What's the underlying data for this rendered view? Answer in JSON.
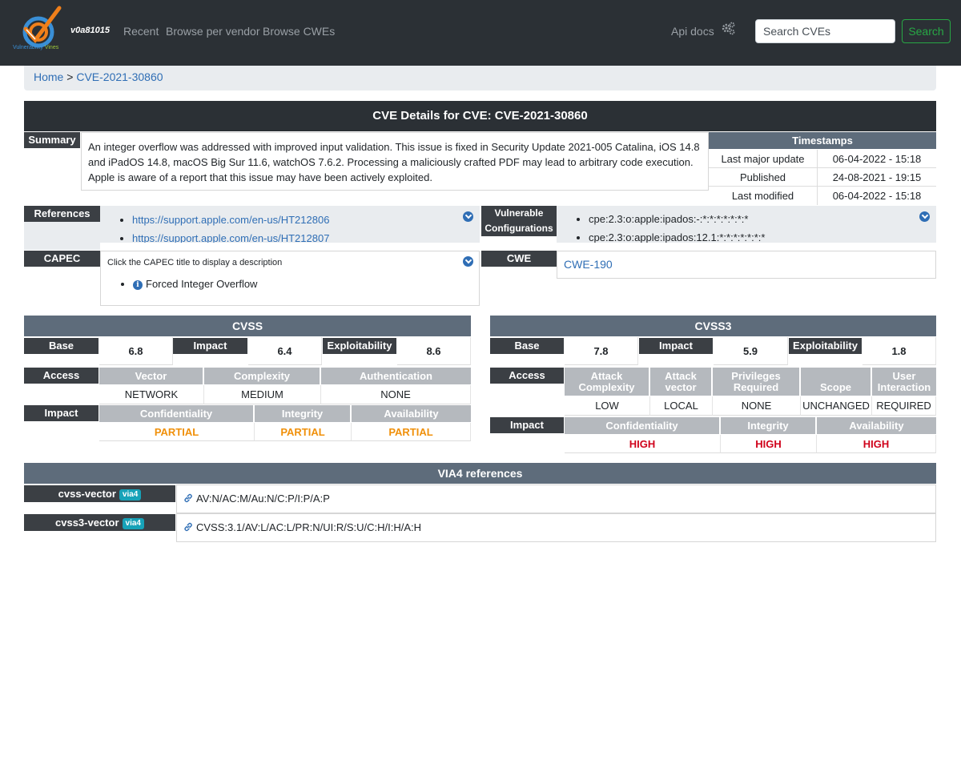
{
  "nav": {
    "brand_line1": "Vulnerability",
    "brand_line2": "Vines",
    "version": "v0a81015",
    "links": [
      "Recent",
      "Browse per vendor",
      "Browse CWEs"
    ],
    "api_docs": "Api docs",
    "search_placeholder": "Search CVEs",
    "search_button": "Search"
  },
  "breadcrumb": {
    "home": "Home",
    "sep": ">",
    "current": "CVE-2021-30860"
  },
  "title": "CVE Details for CVE: CVE-2021-30860",
  "summary": {
    "label": "Summary",
    "text": "An integer overflow was addressed with improved input validation. This issue is fixed in Security Update 2021-005 Catalina, iOS 14.8 and iPadOS 14.8, macOS Big Sur 11.6, watchOS 7.6.2. Processing a maliciously crafted PDF may lead to arbitrary code execution. Apple is aware of a report that this issue may have been actively exploited."
  },
  "timestamps": {
    "header": "Timestamps",
    "rows": [
      {
        "label": "Last major update",
        "value": "06-04-2022 - 15:18"
      },
      {
        "label": "Published",
        "value": "24-08-2021 - 19:15"
      },
      {
        "label": "Last modified",
        "value": "06-04-2022 - 15:18"
      }
    ]
  },
  "references": {
    "label": "References",
    "items": [
      "https://support.apple.com/en-us/HT212806",
      "https://support.apple.com/en-us/HT212807"
    ]
  },
  "vulnerable": {
    "label_line1": "Vulnerable",
    "label_line2": "Configurations",
    "items": [
      "cpe:2.3:o:apple:ipados:-:*:*:*:*:*:*:*",
      "cpe:2.3:o:apple:ipados:12.1:*:*:*:*:*:*:*"
    ]
  },
  "capec": {
    "label": "CAPEC",
    "hint": "Click the CAPEC title to display a description",
    "items": [
      "Forced Integer Overflow"
    ]
  },
  "cwe": {
    "label": "CWE",
    "value": "CWE-190"
  },
  "cvss": {
    "header": "CVSS",
    "base_label": "Base",
    "base": "6.8",
    "impact_label": "Impact",
    "impact": "6.4",
    "exploit_label": "Exploitability",
    "exploit": "8.6",
    "access_label": "Access",
    "access_headers": [
      "Vector",
      "Complexity",
      "Authentication"
    ],
    "access_values": [
      "NETWORK",
      "MEDIUM",
      "NONE"
    ],
    "impact_row_label": "Impact",
    "impact_headers": [
      "Confidentiality",
      "Integrity",
      "Availability"
    ],
    "impact_values": [
      "PARTIAL",
      "PARTIAL",
      "PARTIAL"
    ]
  },
  "cvss3": {
    "header": "CVSS3",
    "base_label": "Base",
    "base": "7.8",
    "impact_label": "Impact",
    "impact": "5.9",
    "exploit_label": "Exploitability",
    "exploit": "1.8",
    "access_label": "Access",
    "access_headers": [
      {
        "l1": "Attack",
        "l2": "Complexity"
      },
      {
        "l1": "Attack",
        "l2": "vector"
      },
      {
        "l1": "Privileges",
        "l2": "Required"
      },
      {
        "l1": "",
        "l2": "Scope"
      },
      {
        "l1": "User",
        "l2": "Interaction"
      }
    ],
    "access_values": [
      "LOW",
      "LOCAL",
      "NONE",
      "UNCHANGED",
      "REQUIRED"
    ],
    "impact_row_label": "Impact",
    "impact_headers": [
      "Confidentiality",
      "Integrity",
      "Availability"
    ],
    "impact_values": [
      "HIGH",
      "HIGH",
      "HIGH"
    ]
  },
  "via4": {
    "header": "VIA4 references",
    "rows": [
      {
        "label": "cvss-vector",
        "badge": "via4",
        "value": "AV:N/AC:M/Au:N/C:P/I:P/A:P"
      },
      {
        "label": "cvss3-vector",
        "badge": "via4",
        "value": "CVSS:3.1/AV:L/AC:L/PR:N/UI:R/S:U/C:H/I:H/A:H"
      }
    ]
  },
  "colors": {
    "navbar": "#2b3035",
    "section_header": "#5e6c7b",
    "label_bg": "#3b3f44",
    "link": "#2f6eb5",
    "partial": "#f0900a",
    "high": "#d0021b",
    "search": "#28a745"
  }
}
